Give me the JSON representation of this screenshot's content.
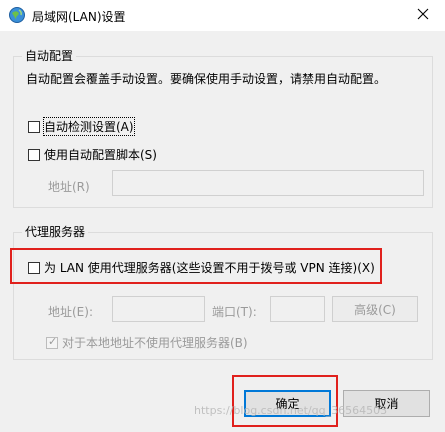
{
  "window": {
    "title": "局域网(LAN)设置",
    "close_icon": "close-icon"
  },
  "auto_config": {
    "group_label": "自动配置",
    "description": "自动配置会覆盖手动设置。要确保使用手动设置，请禁用自动配置。",
    "auto_detect_label": "自动检测设置(A)",
    "auto_detect_checked": false,
    "use_script_label": "使用自动配置脚本(S)",
    "use_script_checked": false,
    "address_label": "地址(R)",
    "address_value": ""
  },
  "proxy": {
    "group_label": "代理服务器",
    "use_proxy_label": "为 LAN 使用代理服务器(这些设置不用于拨号或 VPN 连接)(X)",
    "use_proxy_checked": false,
    "address_label": "地址(E):",
    "address_value": "",
    "port_label": "端口(T):",
    "port_value": "",
    "advanced_label": "高级(C)",
    "bypass_local_label": "对于本地地址不使用代理服务器(B)",
    "bypass_local_checked": true
  },
  "buttons": {
    "ok_label": "确定",
    "cancel_label": "取消"
  },
  "watermark": "https://blog.csdn.net/qq_36564503",
  "colors": {
    "highlight": "#e0201c",
    "focus_accent": "#0078d7"
  }
}
